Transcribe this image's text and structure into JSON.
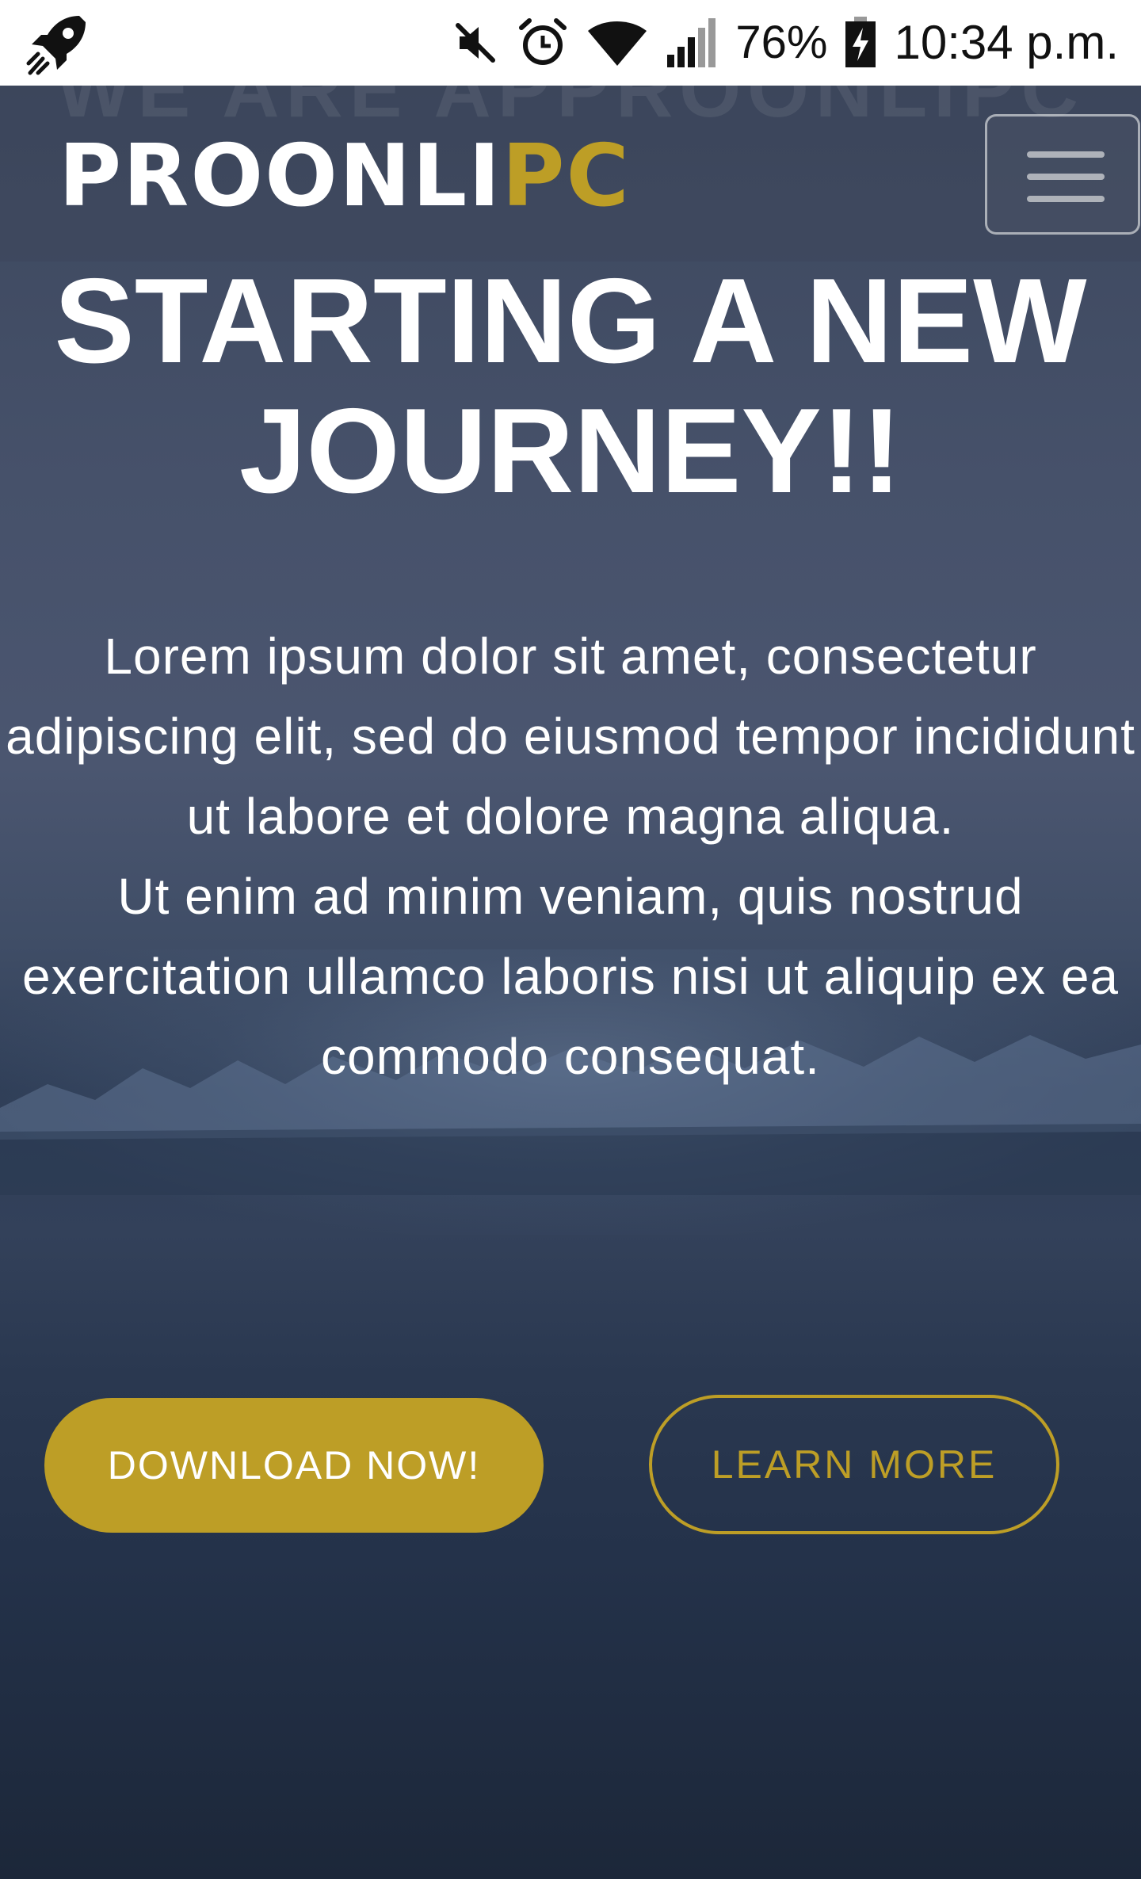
{
  "status_bar": {
    "app_icon": "rocket-icon",
    "mute_icon": "volume-muted-icon",
    "alarm_icon": "alarm-clock-icon",
    "wifi_icon": "wifi-icon",
    "signal_icon": "cellular-signal-icon",
    "battery_percent": "76%",
    "battery_icon": "battery-charging-icon",
    "time": "10:34 p.m."
  },
  "hero": {
    "ghost_text": "WE ARE APPROONLIPC",
    "headline": "STARTING A NEW JOURNEY!!",
    "description": [
      "Lorem ipsum dolor sit amet, consectetur adipiscing elit, sed do eiusmod tempor incididunt ut labore et dolore magna aliqua.",
      "Ut enim ad minim veniam, quis nostrud exercitation ullamco laboris nisi ut aliquip ex ea commodo consequat."
    ],
    "primary_button": "DOWNLOAD NOW!",
    "secondary_button": "LEARN MORE"
  },
  "navbar": {
    "logo_main": "PROONLI",
    "logo_accent": "PC",
    "menu_icon": "hamburger-menu-icon"
  },
  "colors": {
    "accent": "#bd9e26",
    "overlay": "#3c475d",
    "text": "#ffffff"
  }
}
